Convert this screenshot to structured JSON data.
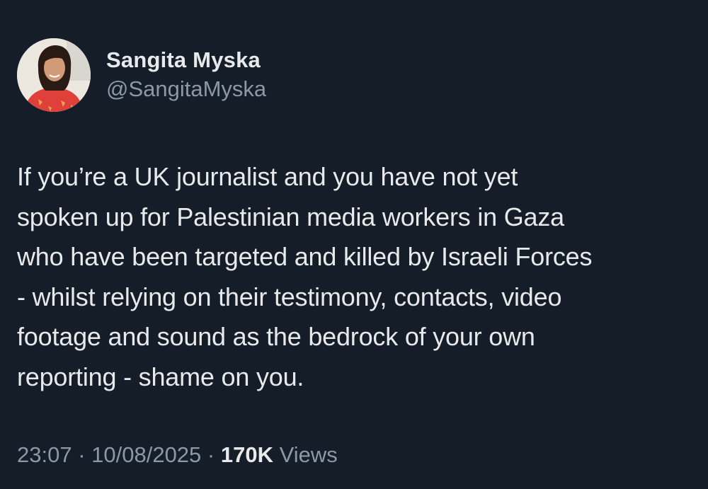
{
  "author": {
    "display_name": "Sangita Myska",
    "handle": "@SangitaMyska"
  },
  "tweet": {
    "text_lines": [
      "If you’re a UK journalist and you have not yet",
      "spoken up for Palestinian media workers in Gaza",
      "who have been targeted and killed by Israeli Forces",
      "- whilst relying on their testimony, contacts, video",
      "footage and sound as the bedrock of your own",
      "reporting - shame on you."
    ]
  },
  "meta": {
    "time": "23:07",
    "separator": " · ",
    "date": "10/08/2025",
    "views_count": "170K",
    "views_label": " Views"
  },
  "colors": {
    "background": "#151d28",
    "primary_text": "#e7e9ea",
    "secondary_text": "#8b98a5"
  }
}
